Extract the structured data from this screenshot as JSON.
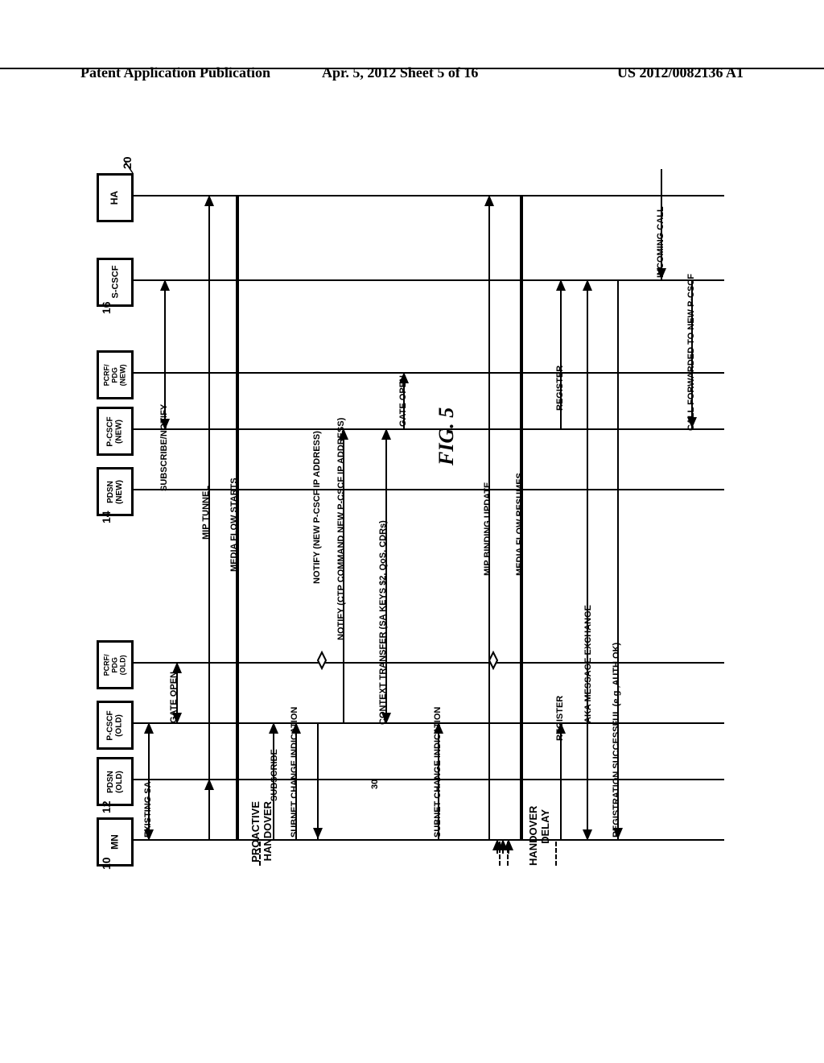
{
  "header": {
    "left": "Patent Application Publication",
    "center": "Apr. 5, 2012  Sheet 5 of 16",
    "right": "US 2012/0082136 A1"
  },
  "figure": {
    "label": "FIG. 5"
  },
  "actors": {
    "mn": "MN",
    "pdsn_old": "PDSN\n(OLD)",
    "pcscf_old": "P-CSCF\n(OLD)",
    "pcrf_old": "PCRF/\nPDG\n(OLD)",
    "pdsn_new": "PDSN\n(NEW)",
    "pcscf_new": "P-CSCF\n(NEW)",
    "pcrf_new": "PCRF/\nPDG\n(NEW)",
    "scscf": "S-CSCF",
    "ha": "HA"
  },
  "refs": {
    "mn": "10",
    "old": "12",
    "new": "14",
    "scscf": "16",
    "ha": "20",
    "ctx": "30"
  },
  "phases": {
    "proactive": "PROACTIVE\nHANDOVER",
    "delay": "HANDOVER\nDELAY"
  },
  "messages": {
    "existing_sa": "EXISTING SA",
    "gate_open_old": "GATE OPEN",
    "subscribe_notify": "SUBSCRIBE/NOTIFY",
    "mip_tunnel": "MIP TUNNEL",
    "media_flow_starts": "MEDIA FLOW STARTS",
    "subscribe": "SUBSCRIBE",
    "subnet_change_1": "SUBNET CHANGE INDICATION",
    "notify_new_pcscf": "NOTIFY (NEW P-CSCF IP ADDRESS)",
    "notify_ctp": "NOTIFY (CTP COMMAND NEW P-CSCF IP ADDRESS)",
    "context_transfer": "CONTEXT TRANSFER (SA KEYS $2, QoS, CDRs)",
    "gate_open_new": "GATE OPEN",
    "subnet_change_2": "SUBNET CHANGE INDICATION",
    "mip_binding": "MIP BINDING UPDATE",
    "media_flow_resumes": "MEDIA FLOW RESUMES",
    "register_1": "REGISTER",
    "register_2": "REGISTER",
    "aka_exchange": "AKA MESSAGE EXCHANGE",
    "reg_success": "REGISTRATION SUCCESSFUL (e.g.,AUTH OK)",
    "incoming_call": "INCOMING CALL",
    "call_forwarded": "CALL FORWARDED TO NEW P-CSCF"
  }
}
